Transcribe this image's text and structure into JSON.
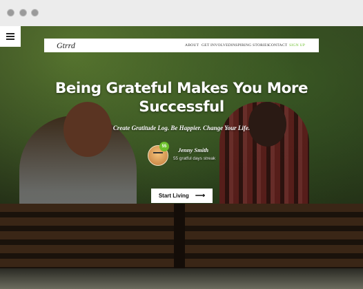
{
  "window": {
    "controls": [
      "close",
      "minimize",
      "maximize"
    ]
  },
  "menu": {
    "icon": "hamburger-menu-icon"
  },
  "navbar": {
    "logo": "Gtrrd",
    "links": [
      {
        "label": "ABOUT"
      },
      {
        "label": "GET INVOLVED"
      },
      {
        "label": "INSPIRING STORIES"
      },
      {
        "label": "CONTACT"
      },
      {
        "label": "SIGN UP",
        "color": "#6cbf2b"
      }
    ]
  },
  "hero": {
    "title": "Being Grateful Makes You More Successful",
    "subtitle": "Create Gratitude Log. Be Happier. Change Your Life."
  },
  "user": {
    "badge": "55",
    "name": "Jenny Smith",
    "streak": "55 gratful days streak"
  },
  "cta": {
    "label": "Start Living",
    "icon": "arrow-right-icon"
  },
  "colors": {
    "accent": "#6cbf2b",
    "chrome": "#ececec"
  }
}
